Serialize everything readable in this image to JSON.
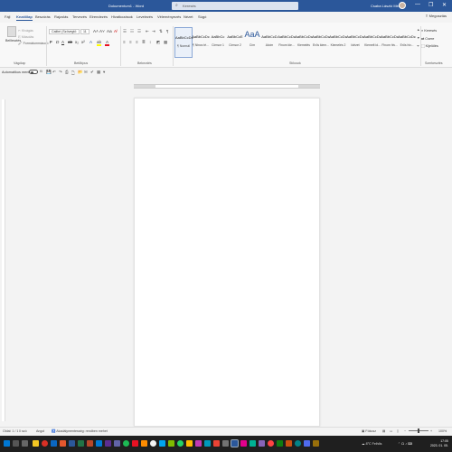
{
  "window": {
    "title": "Dokumentum1 - Word",
    "user_name": "Csaba László Mérő",
    "controls": [
      "—",
      "❐",
      "✕"
    ]
  },
  "search": {
    "placeholder": "Keresés"
  },
  "ribbon_tabs": [
    "Fájl",
    "Kezdőlap",
    "Beszúrás",
    "Rajzolás",
    "Tervezés",
    "Elrendezés",
    "Hivatkozások",
    "Levelezés",
    "Véleményezés",
    "Nézet",
    "Súgó"
  ],
  "share_label": "Megosztás",
  "clipboard": {
    "paste_label": "Beillesztés",
    "items": [
      "Kivágás",
      "Másolás",
      "Formátummásoló"
    ],
    "group_label": "Vágólap"
  },
  "font": {
    "name": "Calibri (Szövegtö",
    "size": "11",
    "group_label": "Betűtípus",
    "buttons": [
      "F",
      "D",
      "A",
      "ab",
      "x₂",
      "x²"
    ],
    "colors": {
      "highlight": "#ffff00",
      "font_color": "#e81123"
    }
  },
  "paragraph": {
    "group_label": "Bekezdés"
  },
  "styles": {
    "group_label": "Stílusok",
    "items": [
      {
        "sample": "AaBbCcDc",
        "name": "¶ Normál"
      },
      {
        "sample": "AaBbCcDc",
        "name": "¶ Nincs té..."
      },
      {
        "sample": "AaBbCc",
        "name": "Címsor 1"
      },
      {
        "sample": "AaBbCcE",
        "name": "Címsor 2"
      },
      {
        "sample": "AaA",
        "name": "Cím"
      },
      {
        "sample": "AaBbCcD",
        "name": "Alcím"
      },
      {
        "sample": "AaBbCcDc",
        "name": "Finom kie..."
      },
      {
        "sample": "AaBbCcDc",
        "name": "Kiemelés"
      },
      {
        "sample": "AaBbCcDc",
        "name": "Erős kiem..."
      },
      {
        "sample": "AaBbCcDc",
        "name": "Kiemelés 2"
      },
      {
        "sample": "AaBbCcDc",
        "name": "Idézet"
      },
      {
        "sample": "AaBbCcDc",
        "name": "Kiemelt id..."
      },
      {
        "sample": "AaBbCcDc",
        "name": "Finom hiv..."
      },
      {
        "sample": "AaBbCcDc",
        "name": "Erős hiv..."
      }
    ]
  },
  "editing": {
    "items": [
      "Keresés",
      "Csere",
      "Kijelölés"
    ],
    "group_label": "Szerkesztés"
  },
  "autosave": {
    "label": "Automatikus mentés",
    "state": "Ki"
  },
  "statusbar": {
    "page": "Oldal: 1 / 1",
    "words": "0 szó",
    "language": "Angol",
    "accessibility": "Akadálymentesség: rendben mehet",
    "focus": "Fókusz",
    "zoom": "100%"
  },
  "taskbar": {
    "weather": "8°C",
    "weather_desc": "Felhős",
    "time": "17:05",
    "date": "2023. 01. 05."
  }
}
